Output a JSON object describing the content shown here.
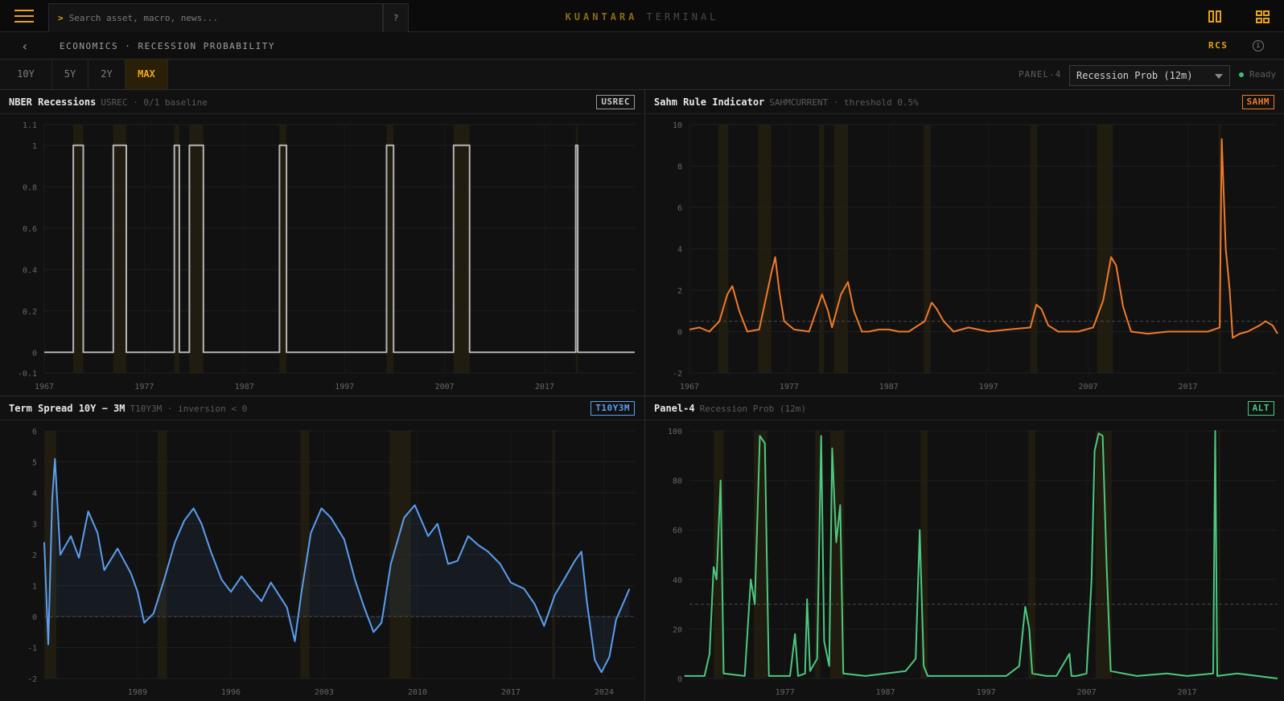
{
  "topbar": {
    "search_prompt": ">",
    "search_placeholder": "Search asset, macro, news...",
    "help_label": "?",
    "brand_primary": "KUANTARA",
    "brand_secondary": "TERMINAL"
  },
  "subbar": {
    "back_label": "‹",
    "breadcrumb": "ECONOMICS · RECESSION PROBABILITY",
    "ticker": "RCS",
    "info_label": "i"
  },
  "ranges": {
    "tabs": [
      "10Y",
      "5Y",
      "2Y",
      "MAX"
    ],
    "active": "MAX",
    "panel_label": "PANEL-4",
    "panel_select": "Recession Prob (12m)",
    "status": "Ready"
  },
  "colors": {
    "accent": "#e8a317",
    "usrec": "#b5b5b5",
    "sahm": "#f07a2a",
    "t10y3m": "#5b9ef0",
    "alt": "#4cc97e",
    "recession_band": "#2e2710",
    "status_ready": "#3fbe73"
  },
  "panels": [
    {
      "title": "NBER Recessions",
      "subtitle": "USREC · 0/1 baseline",
      "badge": "USREC"
    },
    {
      "title": "Sahm Rule Indicator",
      "subtitle": "SAHMCURRENT · threshold 0.5%",
      "badge": "SAHM"
    },
    {
      "title": "Term Spread 10Y − 3M",
      "subtitle": "T10Y3M · inversion < 0",
      "badge": "T10Y3M"
    },
    {
      "title": "Panel-4",
      "subtitle": "Recession Prob (12m)",
      "badge": "ALT"
    }
  ],
  "chart_data": [
    {
      "type": "line",
      "series": [
        {
          "values": [
            [
              1967,
              0
            ],
            [
              1969.9,
              0
            ],
            [
              1969.9,
              1
            ],
            [
              1970.9,
              1
            ],
            [
              1970.9,
              0
            ],
            [
              1973.9,
              0
            ],
            [
              1973.9,
              1
            ],
            [
              1975.2,
              1
            ],
            [
              1975.2,
              0
            ],
            [
              1980.0,
              0
            ],
            [
              1980.0,
              1
            ],
            [
              1980.5,
              1
            ],
            [
              1980.5,
              0
            ],
            [
              1981.5,
              0
            ],
            [
              1981.5,
              1
            ],
            [
              1982.9,
              1
            ],
            [
              1982.9,
              0
            ],
            [
              1990.5,
              0
            ],
            [
              1990.5,
              1
            ],
            [
              1991.2,
              1
            ],
            [
              1991.2,
              0
            ],
            [
              2001.2,
              0
            ],
            [
              2001.2,
              1
            ],
            [
              2001.9,
              1
            ],
            [
              2001.9,
              0
            ],
            [
              2007.9,
              0
            ],
            [
              2007.9,
              1
            ],
            [
              2009.5,
              1
            ],
            [
              2009.5,
              0
            ],
            [
              2020.1,
              0
            ],
            [
              2020.1,
              1
            ],
            [
              2020.3,
              1
            ],
            [
              2020.3,
              0
            ],
            [
              2026,
              0
            ]
          ]
        }
      ],
      "xticks": [
        1967,
        1977,
        1987,
        1997,
        2007,
        2017
      ],
      "yticks": [
        "1.1",
        "1",
        "0.8",
        "0.6",
        "0.4",
        "0.2",
        "0",
        "-0.1"
      ],
      "xlim": [
        1967,
        2026
      ],
      "ylim": [
        -0.1,
        1.1
      ],
      "recessions": [
        [
          1969.9,
          1970.9
        ],
        [
          1973.9,
          1975.2
        ],
        [
          1980.0,
          1980.5
        ],
        [
          1981.5,
          1982.9
        ],
        [
          1990.5,
          1991.2
        ],
        [
          2001.2,
          2001.9
        ],
        [
          2007.9,
          2009.5
        ],
        [
          2020.1,
          2020.3
        ]
      ]
    },
    {
      "type": "line",
      "series": [
        {
          "values": [
            [
              1967,
              0.1
            ],
            [
              1968,
              0.2
            ],
            [
              1969,
              0
            ],
            [
              1970,
              0.5
            ],
            [
              1970.8,
              1.8
            ],
            [
              1971.3,
              2.2
            ],
            [
              1972,
              1
            ],
            [
              1972.8,
              0
            ],
            [
              1974,
              0.1
            ],
            [
              1975.2,
              2.8
            ],
            [
              1975.6,
              3.6
            ],
            [
              1976,
              2
            ],
            [
              1976.5,
              0.5
            ],
            [
              1977.5,
              0.1
            ],
            [
              1979,
              0
            ],
            [
              1980.3,
              1.8
            ],
            [
              1980.9,
              1
            ],
            [
              1981.3,
              0.2
            ],
            [
              1982.2,
              1.8
            ],
            [
              1982.9,
              2.4
            ],
            [
              1983.5,
              1
            ],
            [
              1984.3,
              0
            ],
            [
              1985,
              0
            ],
            [
              1986,
              0.1
            ],
            [
              1987,
              0.1
            ],
            [
              1988,
              0
            ],
            [
              1989,
              0
            ],
            [
              1990.6,
              0.5
            ],
            [
              1991.3,
              1.4
            ],
            [
              1991.8,
              1.1
            ],
            [
              1992.5,
              0.5
            ],
            [
              1993.5,
              0
            ],
            [
              1995,
              0.2
            ],
            [
              1997,
              0
            ],
            [
              1999,
              0.1
            ],
            [
              2001.2,
              0.2
            ],
            [
              2001.8,
              1.3
            ],
            [
              2002.3,
              1.1
            ],
            [
              2003,
              0.3
            ],
            [
              2004,
              0
            ],
            [
              2006,
              0
            ],
            [
              2007.5,
              0.2
            ],
            [
              2008.5,
              1.5
            ],
            [
              2009.3,
              3.6
            ],
            [
              2009.8,
              3.2
            ],
            [
              2010.5,
              1.2
            ],
            [
              2011.3,
              0
            ],
            [
              2013,
              -0.1
            ],
            [
              2015,
              0
            ],
            [
              2017,
              0
            ],
            [
              2019,
              0
            ],
            [
              2020.2,
              0.2
            ],
            [
              2020.4,
              9.3
            ],
            [
              2020.8,
              4
            ],
            [
              2021.2,
              2
            ],
            [
              2021.5,
              -0.3
            ],
            [
              2022.2,
              -0.1
            ],
            [
              2023,
              0
            ],
            [
              2024.2,
              0.3
            ],
            [
              2024.8,
              0.5
            ],
            [
              2025.5,
              0.3
            ],
            [
              2026,
              -0.1
            ]
          ]
        }
      ],
      "xticks": [
        1967,
        1977,
        1987,
        1997,
        2007,
        2017
      ],
      "yticks": [
        10,
        8,
        6,
        4,
        2,
        0,
        -2
      ],
      "xlim": [
        1967,
        2026
      ],
      "ylim": [
        -2,
        10
      ],
      "threshold": 0.5,
      "recessions": [
        [
          1969.9,
          1970.9
        ],
        [
          1973.9,
          1975.2
        ],
        [
          1980.0,
          1980.5
        ],
        [
          1981.5,
          1982.9
        ],
        [
          1990.5,
          1991.2
        ],
        [
          2001.2,
          2001.9
        ],
        [
          2007.9,
          2009.5
        ],
        [
          2020.1,
          2020.3
        ]
      ]
    },
    {
      "type": "line",
      "series": [
        {
          "values": [
            [
              1982,
              2.4
            ],
            [
              1982.3,
              -0.9
            ],
            [
              1982.6,
              3.8
            ],
            [
              1982.8,
              5.1
            ],
            [
              1983.2,
              2
            ],
            [
              1984,
              2.6
            ],
            [
              1984.6,
              1.9
            ],
            [
              1985.3,
              3.4
            ],
            [
              1986,
              2.7
            ],
            [
              1986.5,
              1.5
            ],
            [
              1987.5,
              2.2
            ],
            [
              1988.5,
              1.4
            ],
            [
              1989,
              0.8
            ],
            [
              1989.5,
              -0.2
            ],
            [
              1990.2,
              0.1
            ],
            [
              1991,
              1.2
            ],
            [
              1991.8,
              2.4
            ],
            [
              1992.5,
              3.1
            ],
            [
              1993.2,
              3.5
            ],
            [
              1993.8,
              3
            ],
            [
              1994.5,
              2.1
            ],
            [
              1995.3,
              1.2
            ],
            [
              1996,
              0.8
            ],
            [
              1996.8,
              1.3
            ],
            [
              1997.5,
              0.9
            ],
            [
              1998.3,
              0.5
            ],
            [
              1999,
              1.1
            ],
            [
              2000.2,
              0.3
            ],
            [
              2000.8,
              -0.8
            ],
            [
              2001.3,
              0.8
            ],
            [
              2002,
              2.7
            ],
            [
              2002.8,
              3.5
            ],
            [
              2003.5,
              3.2
            ],
            [
              2004.5,
              2.5
            ],
            [
              2005.3,
              1.2
            ],
            [
              2006,
              0.3
            ],
            [
              2006.7,
              -0.5
            ],
            [
              2007.3,
              -0.2
            ],
            [
              2008,
              1.7
            ],
            [
              2009,
              3.2
            ],
            [
              2009.8,
              3.6
            ],
            [
              2010.8,
              2.6
            ],
            [
              2011.5,
              3
            ],
            [
              2012.3,
              1.7
            ],
            [
              2013,
              1.8
            ],
            [
              2013.8,
              2.6
            ],
            [
              2014.6,
              2.3
            ],
            [
              2015.3,
              2.1
            ],
            [
              2016.2,
              1.7
            ],
            [
              2017,
              1.1
            ],
            [
              2018,
              0.9
            ],
            [
              2018.8,
              0.4
            ],
            [
              2019.5,
              -0.3
            ],
            [
              2020.3,
              0.7
            ],
            [
              2021,
              1.2
            ],
            [
              2021.8,
              1.8
            ],
            [
              2022.3,
              2.1
            ],
            [
              2022.7,
              0.5
            ],
            [
              2023.3,
              -1.4
            ],
            [
              2023.8,
              -1.8
            ],
            [
              2024.4,
              -1.3
            ],
            [
              2024.9,
              -0.1
            ],
            [
              2025.4,
              0.4
            ],
            [
              2025.9,
              0.9
            ]
          ]
        }
      ],
      "xticks": [
        1989,
        1996,
        2003,
        2010,
        2017,
        2024
      ],
      "yticks": [
        6,
        5,
        4,
        3,
        2,
        1,
        0,
        -1,
        -2
      ],
      "xlim": [
        1982,
        2026.3
      ],
      "ylim": [
        -2,
        6
      ],
      "threshold": 0,
      "recessions": [
        [
          1982,
          1982.9
        ],
        [
          1990.5,
          1991.2
        ],
        [
          2001.2,
          2001.9
        ],
        [
          2007.9,
          2009.5
        ],
        [
          2020.1,
          2020.3
        ]
      ]
    },
    {
      "type": "line",
      "series": [
        {
          "values": [
            [
              1967,
              1
            ],
            [
              1969,
              1
            ],
            [
              1969.5,
              10
            ],
            [
              1969.9,
              45
            ],
            [
              1970.2,
              40
            ],
            [
              1970.6,
              80
            ],
            [
              1970.9,
              2
            ],
            [
              1973,
              1
            ],
            [
              1973.6,
              40
            ],
            [
              1974,
              30
            ],
            [
              1974.5,
              98
            ],
            [
              1975,
              95
            ],
            [
              1975.4,
              1
            ],
            [
              1977.5,
              1
            ],
            [
              1978,
              18
            ],
            [
              1978.3,
              1
            ],
            [
              1979,
              2
            ],
            [
              1979.2,
              32
            ],
            [
              1979.5,
              3
            ],
            [
              1980.2,
              8
            ],
            [
              1980.6,
              98
            ],
            [
              1980.9,
              15
            ],
            [
              1981.4,
              5
            ],
            [
              1981.7,
              93
            ],
            [
              1982.1,
              55
            ],
            [
              1982.5,
              70
            ],
            [
              1982.8,
              2
            ],
            [
              1985,
              1
            ],
            [
              1989,
              3
            ],
            [
              1990,
              8
            ],
            [
              1990.4,
              60
            ],
            [
              1990.8,
              5
            ],
            [
              1991.2,
              1
            ],
            [
              1994,
              1
            ],
            [
              1999,
              1
            ],
            [
              2000.3,
              5
            ],
            [
              2000.9,
              29
            ],
            [
              2001.3,
              20
            ],
            [
              2001.6,
              2
            ],
            [
              2003,
              1
            ],
            [
              2004,
              1
            ],
            [
              2005.3,
              10
            ],
            [
              2005.5,
              1
            ],
            [
              2006,
              1
            ],
            [
              2007,
              2
            ],
            [
              2007.5,
              40
            ],
            [
              2007.8,
              92
            ],
            [
              2008.2,
              99
            ],
            [
              2008.6,
              98
            ],
            [
              2009,
              45
            ],
            [
              2009.4,
              3
            ],
            [
              2012,
              1
            ],
            [
              2015,
              2
            ],
            [
              2017,
              1
            ],
            [
              2019.6,
              2
            ],
            [
              2019.8,
              100
            ],
            [
              2020,
              1
            ],
            [
              2022,
              2
            ],
            [
              2024,
              1
            ],
            [
              2026,
              0
            ]
          ]
        }
      ],
      "xticks": [
        1977,
        1987,
        1997,
        2007,
        2017
      ],
      "yticks": [
        100,
        80,
        60,
        40,
        20,
        0
      ],
      "xlim": [
        1967.5,
        2026
      ],
      "ylim": [
        0,
        100
      ],
      "threshold": 30,
      "recessions": [
        [
          1969.9,
          1970.9
        ],
        [
          1973.9,
          1975.2
        ],
        [
          1980.0,
          1980.5
        ],
        [
          1981.5,
          1982.9
        ],
        [
          1990.5,
          1991.2
        ],
        [
          2001.2,
          2001.9
        ],
        [
          2007.9,
          2009.5
        ],
        [
          2020.1,
          2020.3
        ]
      ]
    }
  ]
}
